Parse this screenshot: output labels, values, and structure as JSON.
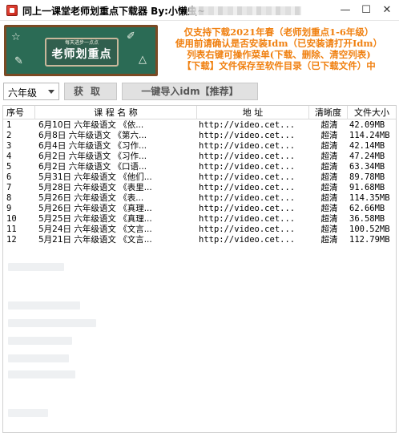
{
  "window": {
    "title": "同上一课堂老师划重点下载器 By:小懒虫~",
    "minimize_glyph": "—",
    "maximize_glyph": "☐",
    "close_glyph": "✕"
  },
  "banner": {
    "board_text": "老师划重点",
    "tiny_text": "每天进步一点点"
  },
  "notice": {
    "lines": [
      "仅支持下载2021年春（老师划重点1-6年级）",
      "使用前请确认是否安装Idm（已安装请打开Idm）",
      "列表右键可操作菜单(下载、删除、清空列表)",
      "【下载】文件保存至软件目录（已下载文件）中"
    ]
  },
  "toolbar": {
    "grade_value": "六年级",
    "fetch_label": "获取",
    "idm_label": "一键导入idm【推荐】"
  },
  "table": {
    "headers": {
      "idx": "序号",
      "name": "课 程 名 称",
      "url": "地     址",
      "quality": "清晰度",
      "size": "文件大小"
    },
    "rows": [
      {
        "idx": "1",
        "name": "6月10日    六年级语文 《依...",
        "url": "http://video.cet...",
        "quality": "超清",
        "size": "42.09MB"
      },
      {
        "idx": "2",
        "name": "6月8日   六年级语文 《第六...",
        "url": "http://video.cet...",
        "quality": "超清",
        "size": "114.24MB"
      },
      {
        "idx": "3",
        "name": "6月4日   六年级语文 《习作...",
        "url": "http://video.cet...",
        "quality": "超清",
        "size": "42.14MB"
      },
      {
        "idx": "4",
        "name": "6月2日   六年级语文 《习作...",
        "url": "http://video.cet...",
        "quality": "超清",
        "size": "47.24MB"
      },
      {
        "idx": "5",
        "name": "6月2日   六年级语文 《口语...",
        "url": "http://video.cet...",
        "quality": "超清",
        "size": "63.34MB"
      },
      {
        "idx": "6",
        "name": "5月31日  六年级语文 《他们...",
        "url": "http://video.cet...",
        "quality": "超清",
        "size": "89.78MB"
      },
      {
        "idx": "7",
        "name": "5月28日   六年级语文 《表里...",
        "url": "http://video.cet...",
        "quality": "超清",
        "size": "91.68MB"
      },
      {
        "idx": "8",
        "name": "5月26日     六年级语文 《表...",
        "url": "http://video.cet...",
        "quality": "超清",
        "size": "114.35MB"
      },
      {
        "idx": "9",
        "name": "5月26日   六年级语文 《真理...",
        "url": "http://video.cet...",
        "quality": "超清",
        "size": "62.66MB"
      },
      {
        "idx": "10",
        "name": "5月25日   六年级语文 《真理...",
        "url": "http://video.cet...",
        "quality": "超清",
        "size": "36.58MB"
      },
      {
        "idx": "11",
        "name": "5月24日   六年级语文 《文言...",
        "url": "http://video.cet...",
        "quality": "超清",
        "size": "100.52MB"
      },
      {
        "idx": "12",
        "name": "5月21日   六年级语文 《文言...",
        "url": "http://video.cet...",
        "quality": "超清",
        "size": "112.79MB"
      }
    ]
  },
  "colors": {
    "notice_orange": "#f08010",
    "chalkboard_green": "#2b6b55",
    "board_frame": "#7a4a24"
  }
}
